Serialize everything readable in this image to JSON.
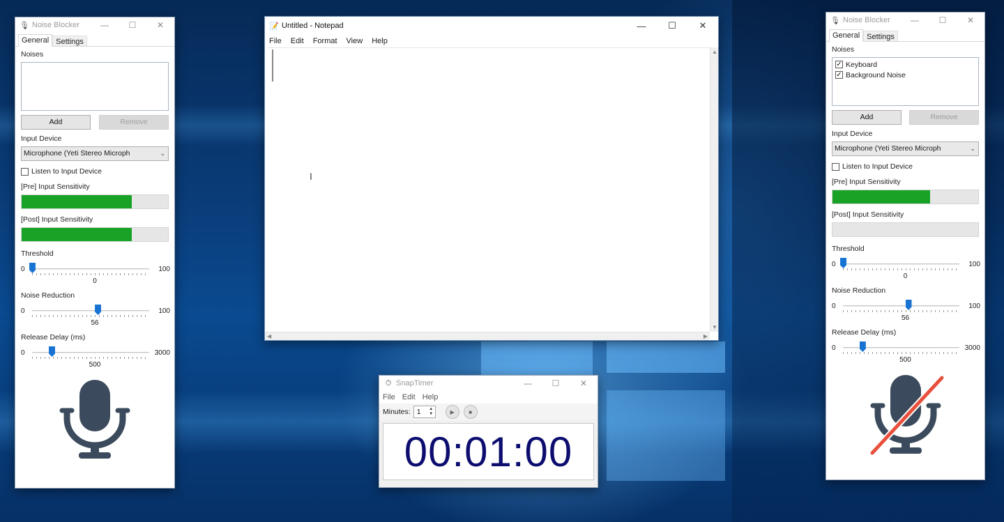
{
  "left_blocker": {
    "title": "Noise Blocker",
    "tabs": [
      "General",
      "Settings"
    ],
    "noises_label": "Noises",
    "noises": [],
    "add_label": "Add",
    "remove_label": "Remove",
    "input_device_label": "Input Device",
    "input_device": "Microphone (Yeti Stereo Microph",
    "listen_label": "Listen to Input Device",
    "listen_checked": false,
    "pre_label": "[Pre] Input Sensitivity",
    "pre_level": 0.75,
    "post_label": "[Post] Input Sensitivity",
    "post_level": 0.75,
    "threshold": {
      "label": "Threshold",
      "min": "0",
      "max": "100",
      "value": "0",
      "fraction": 0.0
    },
    "reduction": {
      "label": "Noise Reduction",
      "min": "0",
      "max": "100",
      "value": "56",
      "fraction": 0.56
    },
    "release": {
      "label": "Release Delay (ms)",
      "min": "0",
      "max": "3000",
      "value": "500",
      "fraction": 0.1667
    },
    "mic_state": "active",
    "mic_icon": "microphone-icon"
  },
  "right_blocker": {
    "title": "Noise Blocker",
    "tabs": [
      "General",
      "Settings"
    ],
    "noises_label": "Noises",
    "noises": [
      {
        "label": "Keyboard",
        "checked": true
      },
      {
        "label": "Background Noise",
        "checked": true
      }
    ],
    "add_label": "Add",
    "remove_label": "Remove",
    "input_device_label": "Input Device",
    "input_device": "Microphone (Yeti Stereo Microph",
    "listen_label": "Listen to Input Device",
    "listen_checked": false,
    "pre_label": "[Pre] Input Sensitivity",
    "pre_level": 0.67,
    "post_label": "[Post] Input Sensitivity",
    "post_level": 0.0,
    "threshold": {
      "label": "Threshold",
      "min": "0",
      "max": "100",
      "value": "0",
      "fraction": 0.0
    },
    "reduction": {
      "label": "Noise Reduction",
      "min": "0",
      "max": "100",
      "value": "56",
      "fraction": 0.56
    },
    "release": {
      "label": "Release Delay (ms)",
      "min": "0",
      "max": "3000",
      "value": "500",
      "fraction": 0.1667
    },
    "mic_state": "muted",
    "mic_icon": "microphone-muted-icon"
  },
  "notepad": {
    "title": "Untitled - Notepad",
    "menu": [
      "File",
      "Edit",
      "Format",
      "View",
      "Help"
    ],
    "content": ""
  },
  "snaptimer": {
    "title": "SnapTimer",
    "menu": [
      "File",
      "Edit",
      "Help"
    ],
    "minutes_label": "Minutes:",
    "minutes_value": "1",
    "display": "00:01:00"
  },
  "colors": {
    "meter_green": "#18a327",
    "slider_blue": "#1873d3",
    "mic_gray": "#3b4a5c",
    "mute_red": "#e8503c",
    "timer_text": "#0d0d6f"
  },
  "window_controls": {
    "minimize": "—",
    "maximize": "☐",
    "close": "✕"
  }
}
